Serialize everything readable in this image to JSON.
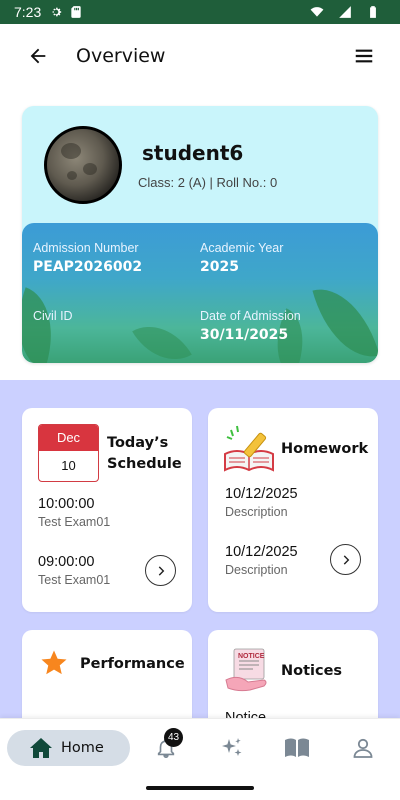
{
  "status_bar": {
    "time": "7:23",
    "icons": [
      "gear-icon",
      "sd-card-icon",
      "wifi-icon",
      "signal-icon",
      "battery-icon"
    ]
  },
  "app_bar": {
    "title": "Overview",
    "icons": [
      "back-arrow-icon",
      "hamburger-menu-icon"
    ]
  },
  "profile": {
    "name": "student6",
    "class_line": "Class: 2 (A) |  Roll No.: 0",
    "admission_number_label": "Admission Number",
    "admission_number": "PEAP2026002",
    "academic_year_label": "Academic Year",
    "academic_year": "2025",
    "civil_id_label": "Civil ID",
    "civil_id": "",
    "date_of_admission_label": "Date of Admission",
    "date_of_admission": "30/11/2025"
  },
  "schedule": {
    "title_line1": "Today’s",
    "title_line2": "Schedule",
    "calendar_month": "Dec",
    "calendar_day": "10",
    "items": [
      {
        "time": "10:00:00",
        "name": "Test Exam01"
      },
      {
        "time": "09:00:00",
        "name": "Test Exam01"
      }
    ]
  },
  "homework": {
    "title": "Homework",
    "items": [
      {
        "date": "10/12/2025",
        "description": "Description"
      },
      {
        "date": "10/12/2025",
        "description": "Description"
      }
    ]
  },
  "performance": {
    "title": "Performance"
  },
  "notices": {
    "title": "Notices",
    "notice_image_text": "NOTICE",
    "peek_text": "Notice"
  },
  "bottom_nav": {
    "home_label": "Home",
    "notification_count": "43",
    "items": [
      "home-icon",
      "bell-icon",
      "sparkle-icon",
      "book-icon",
      "profile-icon"
    ]
  },
  "colors": {
    "status_bar": "#1f5e3a",
    "profile_card": "#c9f5fb",
    "lower_background": "#cbd0ff",
    "calendar_red": "#d8353f",
    "star_orange": "#f7861e",
    "home_pill": "#d5dde6"
  }
}
